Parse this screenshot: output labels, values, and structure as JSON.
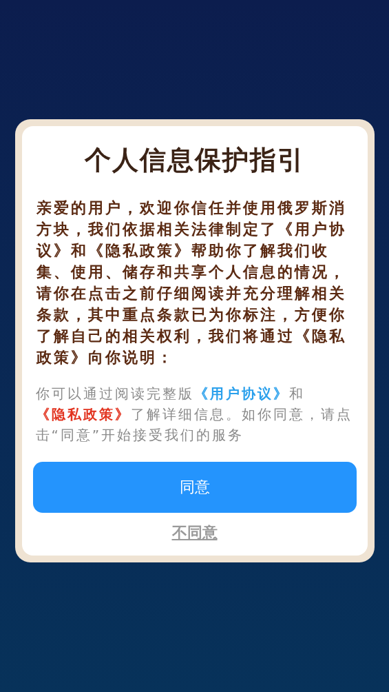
{
  "dialog": {
    "title": "个人信息保护指引",
    "intro": "亲爱的用户，欢迎你信任并使用俄罗斯消方块，我们依据相关法律制定了《用户协议》和《隐私政策》帮助你了解我们收集、使用、储存和共享个人信息的情况，请你在点击之前仔细阅读并充分理解相关条款，其中重点条款已为你标注，方便你了解自己的相关权利，我们将通过《隐私政策》向你说明：",
    "notice": [
      {
        "kind": "text",
        "text": "你可以通过阅读完整版"
      },
      {
        "kind": "link",
        "text": "《用户协议》",
        "color": "#2aa0ec"
      },
      {
        "kind": "text",
        "text": "和"
      },
      {
        "kind": "link",
        "text": "《隐私政策》",
        "color": "#e2331f"
      },
      {
        "kind": "text",
        "text": "了解详细信息。如你同意，请点击“同意”开始接受我们的服务"
      }
    ],
    "buttons": [
      {
        "kind": "primary",
        "label": "同意"
      },
      {
        "kind": "link",
        "label": "不同意"
      }
    ]
  }
}
